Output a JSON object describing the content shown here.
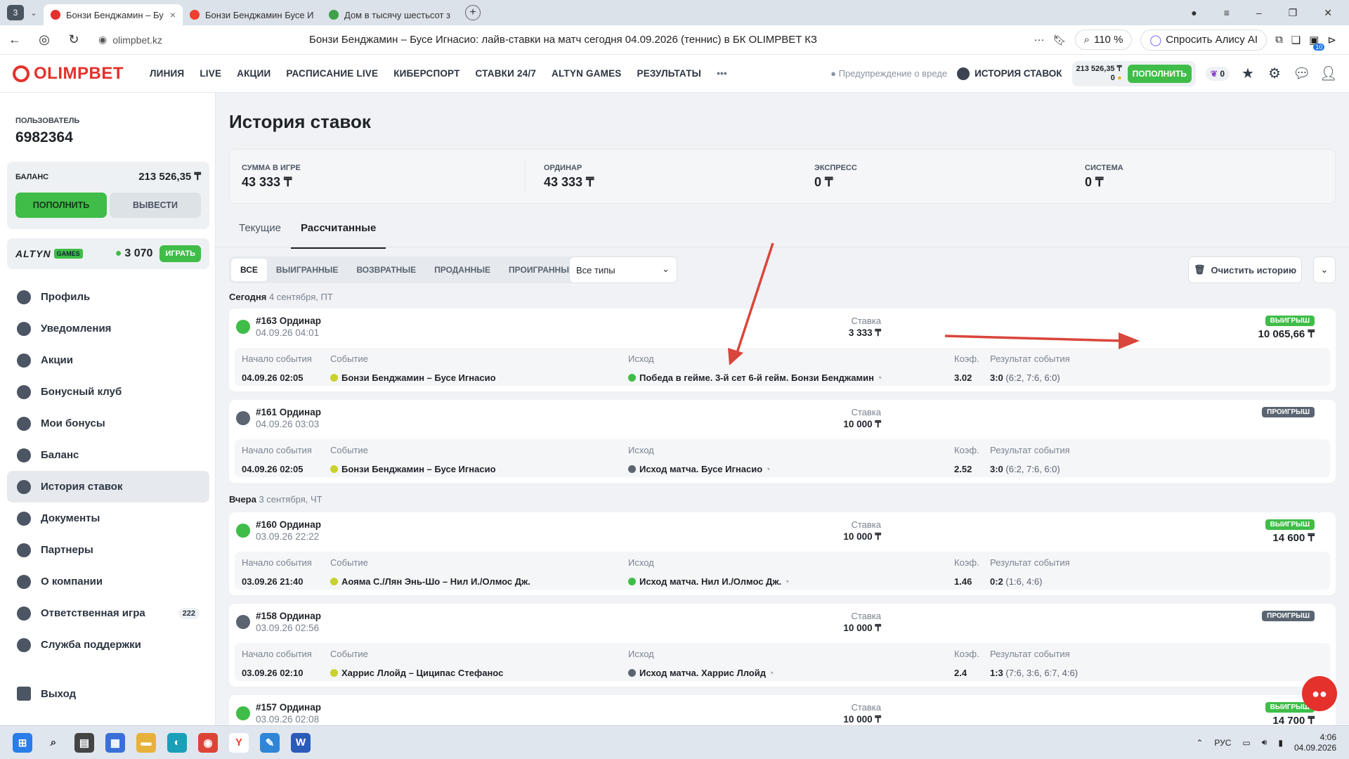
{
  "browser": {
    "tab_count": "3",
    "tabs": [
      {
        "title": "Бонзи Бенджамин – Бу",
        "color": "#e4312b",
        "active": true
      },
      {
        "title": "Бонзи Бенджамин Бусе И",
        "color": "#f03e2f",
        "active": false
      },
      {
        "title": "Дом в тысячу шестьсот з",
        "color": "#3fa14a",
        "active": false
      }
    ],
    "url": "olimpbet.kz",
    "page_title": "Бонзи Бенджамин – Бусе Игнасио: лайв-ставки на матч сегодня 04.09.2026 (теннис) в БК OLIMPBET КЗ",
    "zoom": "110 %",
    "alice": "Спросить Алису AI",
    "ext_badge": "10"
  },
  "header": {
    "logo": "OLIMPBET",
    "nav": [
      "ЛИНИЯ",
      "LIVE",
      "АКЦИИ",
      "РАСПИСАНИЕ LIVE",
      "КИБЕРСПОРТ",
      "СТАВКИ 24/7",
      "ALTYN GAMES",
      "РЕЗУЛЬТАТЫ"
    ],
    "more": "•••",
    "warning": "Предупреждение о вреде",
    "history": "ИСТОРИЯ СТАВОК",
    "balance": "213 526,35 ₸",
    "bonus": "0",
    "deposit": "ПОПОЛНИТЬ",
    "promo_count": "0"
  },
  "sidebar": {
    "user_label": "ПОЛЬЗОВАТЕЛЬ",
    "user_id": "6982364",
    "balance_label": "БАЛАНС",
    "balance_value": "213 526,35 ₸",
    "deposit": "ПОПОЛНИТЬ",
    "withdraw": "ВЫВЕСТИ",
    "altyn_logo": "ALTYN",
    "altyn_games": "GAMES",
    "altyn_points": "3 070",
    "altyn_play": "ИГРАТЬ",
    "items": [
      {
        "label": "Профиль",
        "active": false,
        "badge": ""
      },
      {
        "label": "Уведомления",
        "active": false,
        "badge": ""
      },
      {
        "label": "Акции",
        "active": false,
        "badge": ""
      },
      {
        "label": "Бонусный клуб",
        "active": false,
        "badge": ""
      },
      {
        "label": "Мои бонусы",
        "active": false,
        "badge": ""
      },
      {
        "label": "Баланс",
        "active": false,
        "badge": ""
      },
      {
        "label": "История ставок",
        "active": true,
        "badge": ""
      },
      {
        "label": "Документы",
        "active": false,
        "badge": ""
      },
      {
        "label": "Партнеры",
        "active": false,
        "badge": ""
      },
      {
        "label": "О компании",
        "active": false,
        "badge": ""
      },
      {
        "label": "Ответственная игра",
        "active": false,
        "badge": "222"
      },
      {
        "label": "Служба поддержки",
        "active": false,
        "badge": ""
      }
    ],
    "logout": "Выход"
  },
  "main": {
    "title": "История ставок",
    "summary": [
      {
        "label": "СУММА В ИГРЕ",
        "value": "43 333 ₸"
      },
      {
        "label": "ОРДИНАР",
        "value": "43 333 ₸"
      },
      {
        "label": "ЭКСПРЕСС",
        "value": "0 ₸"
      },
      {
        "label": "СИСТЕМА",
        "value": "0 ₸"
      }
    ],
    "tabs": [
      "Текущие",
      "Рассчитанные"
    ],
    "filters": [
      "ВСЕ",
      "ВЫИГРАННЫЕ",
      "ВОЗВРАТНЫЕ",
      "ПРОДАННЫЕ",
      "ПРОИГРАННЫЕ"
    ],
    "type_select": "Все типы",
    "clear": "Очистить историю",
    "col_labels": {
      "start": "Начало события",
      "event": "Событие",
      "outcome": "Исход",
      "coef": "Коэф.",
      "result": "Результат события",
      "stake": "Ставка"
    },
    "days": [
      {
        "name": "Сегодня",
        "date": "4 сентября, ПТ"
      },
      {
        "name": "Вчера",
        "date": "3 сентября, ЧТ"
      }
    ],
    "bets": [
      {
        "num": "#163 Ординар",
        "dt": "04.09.26 04:01",
        "stake": "3 333 ₸",
        "status": "ВЫИГРЫШ",
        "win": "10 065,66 ₸",
        "start": "04.09.26 02:05",
        "event": "Бонзи Бенджамин – Бусе Игнасио",
        "outcome": "Победа в гейме. 3-й сет 6-й гейм. Бонзи Бенджамин",
        "coef": "3.02",
        "result_main": "3:0",
        "result_sub": "(6:2, 7:6, 6:0)"
      },
      {
        "num": "#161 Ординар",
        "dt": "04.09.26 03:03",
        "stake": "10 000 ₸",
        "status": "ПРОИГРЫШ",
        "win": "",
        "start": "04.09.26 02:05",
        "event": "Бонзи Бенджамин – Бусе Игнасио",
        "outcome": "Исход матча. Бусе Игнасио",
        "coef": "2.52",
        "result_main": "3:0",
        "result_sub": "(6:2, 7:6, 6:0)"
      },
      {
        "num": "#160 Ординар",
        "dt": "03.09.26 22:22",
        "stake": "10 000 ₸",
        "status": "ВЫИГРЫШ",
        "win": "14 600 ₸",
        "start": "03.09.26 21:40",
        "event": "Аояма С./Лян Энь-Шо – Нил И./Олмос Дж.",
        "outcome": "Исход матча. Нил И./Олмос Дж.",
        "coef": "1.46",
        "result_main": "0:2",
        "result_sub": "(1:6, 4:6)"
      },
      {
        "num": "#158 Ординар",
        "dt": "03.09.26 02:56",
        "stake": "10 000 ₸",
        "status": "ПРОИГРЫШ",
        "win": "",
        "start": "03.09.26 02:10",
        "event": "Харрис Ллойд – Циципас Стефанос",
        "outcome": "Исход матча. Харрис Ллойд",
        "coef": "2.4",
        "result_main": "1:3",
        "result_sub": "(7:6, 3:6, 6:7, 4:6)"
      },
      {
        "num": "#157 Ординар",
        "dt": "03.09.26 02:08",
        "stake": "10 000 ₸",
        "status": "ВЫИГРЫШ",
        "win": "14 700 ₸"
      }
    ]
  },
  "taskbar": {
    "lang": "РУС",
    "time": "4:06",
    "date": "04.09.2026"
  },
  "colors": {
    "brand": "#e4312b",
    "win": "#3fbd48",
    "loss": "#5b6572"
  }
}
